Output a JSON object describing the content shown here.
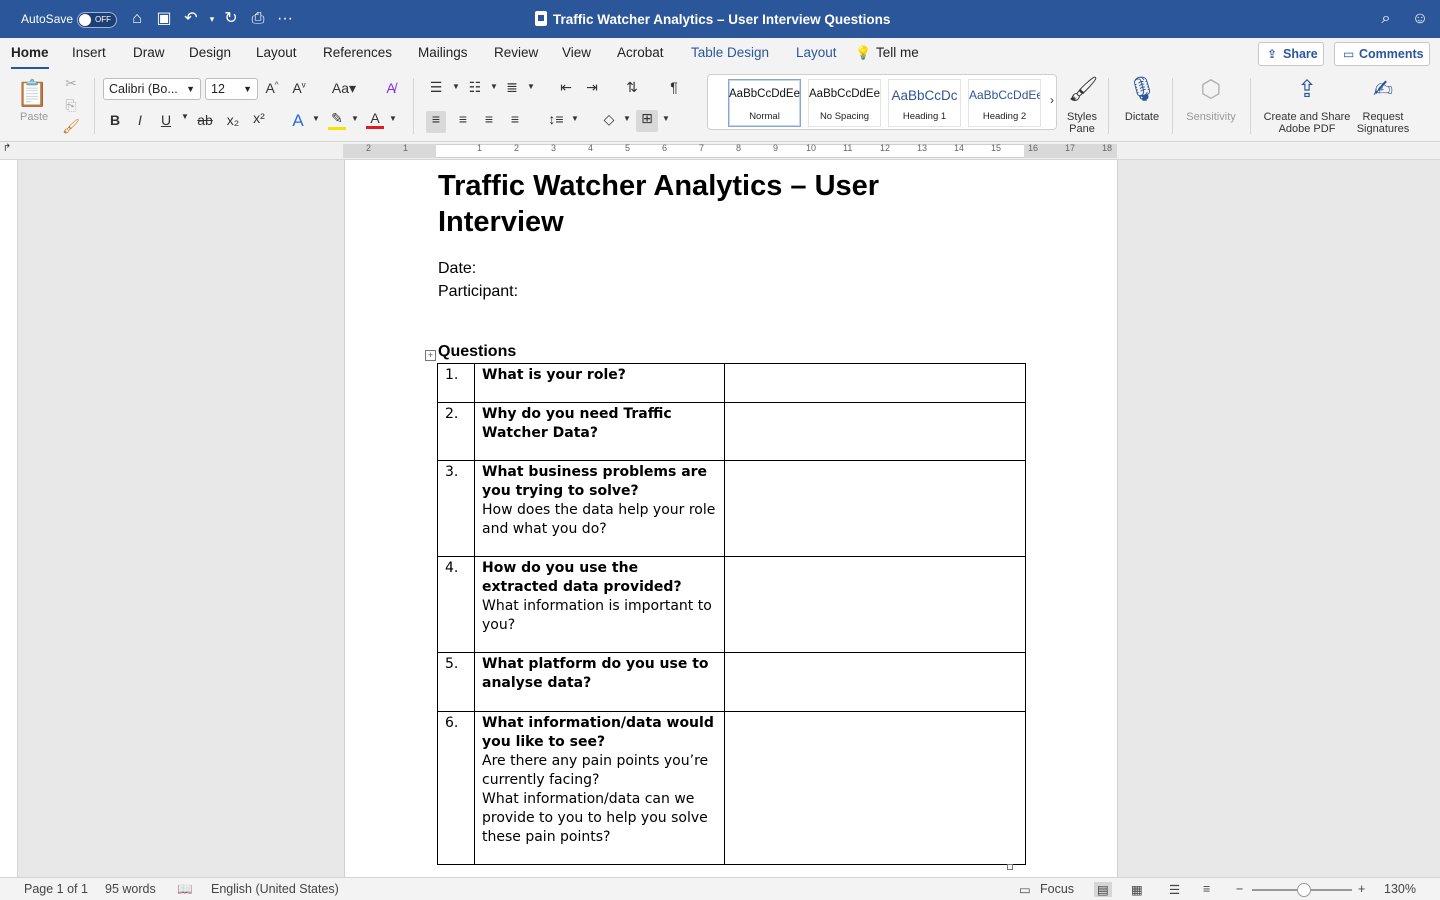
{
  "app": {
    "autosave_label": "AutoSave",
    "autosave_state": "OFF",
    "doc_title": "Traffic Watcher Analytics – User Interview Questions"
  },
  "tabs": [
    "Home",
    "Insert",
    "Draw",
    "Design",
    "Layout",
    "References",
    "Mailings",
    "Review",
    "View",
    "Acrobat",
    "Table Design",
    "Layout",
    "Tell me"
  ],
  "actions": {
    "share": "Share",
    "comments": "Comments"
  },
  "ribbon": {
    "paste": "Paste",
    "font_name": "Calibri (Bo...",
    "font_size": "12",
    "styles": [
      {
        "sample": "AaBbCcDdEe",
        "name": "Normal"
      },
      {
        "sample": "AaBbCcDdEe",
        "name": "No Spacing"
      },
      {
        "sample": "AaBbCcDc",
        "name": "Heading 1"
      },
      {
        "sample": "AaBbCcDdEe",
        "name": "Heading 2"
      }
    ],
    "styles_pane": "Styles Pane",
    "dictate": "Dictate",
    "sensitivity": "Sensitivity",
    "create_share_pdf": "Create and Share Adobe PDF",
    "request_signatures": "Request Signatures"
  },
  "ruler_numbers": [
    "2",
    "1",
    "1",
    "2",
    "3",
    "4",
    "5",
    "6",
    "7",
    "8",
    "9",
    "10",
    "11",
    "12",
    "13",
    "14",
    "15",
    "16",
    "17",
    "18"
  ],
  "document": {
    "title": "Traffic Watcher Analytics – User Interview",
    "date_label": "Date:",
    "participant_label": "Participant:",
    "questions_heading": "Questions",
    "questions": [
      {
        "num": "1.",
        "bold": [
          "What is your role?"
        ],
        "plain": []
      },
      {
        "num": "2.",
        "bold": [
          "Why do you need Traffic Watcher Data?"
        ],
        "plain": []
      },
      {
        "num": "3.",
        "bold": [
          "What business problems are you trying to solve?"
        ],
        "plain": [
          "How does the data help your role and what you do?"
        ]
      },
      {
        "num": "4.",
        "bold": [
          "How do you use the extracted data provided?"
        ],
        "plain": [
          "What information is important to you?"
        ]
      },
      {
        "num": "5.",
        "bold": [
          "What platform do you use to analyse data?"
        ],
        "plain": []
      },
      {
        "num": "6.",
        "bold": [
          "What information/data would you like to see?"
        ],
        "plain": [
          "Are there any pain points you’re currently facing?",
          "What information/data can we provide to you to help you solve these pain points?"
        ]
      }
    ]
  },
  "status": {
    "page": "Page 1 of 1",
    "words": "95 words",
    "language": "English (United States)",
    "focus": "Focus",
    "zoom": "130%"
  }
}
